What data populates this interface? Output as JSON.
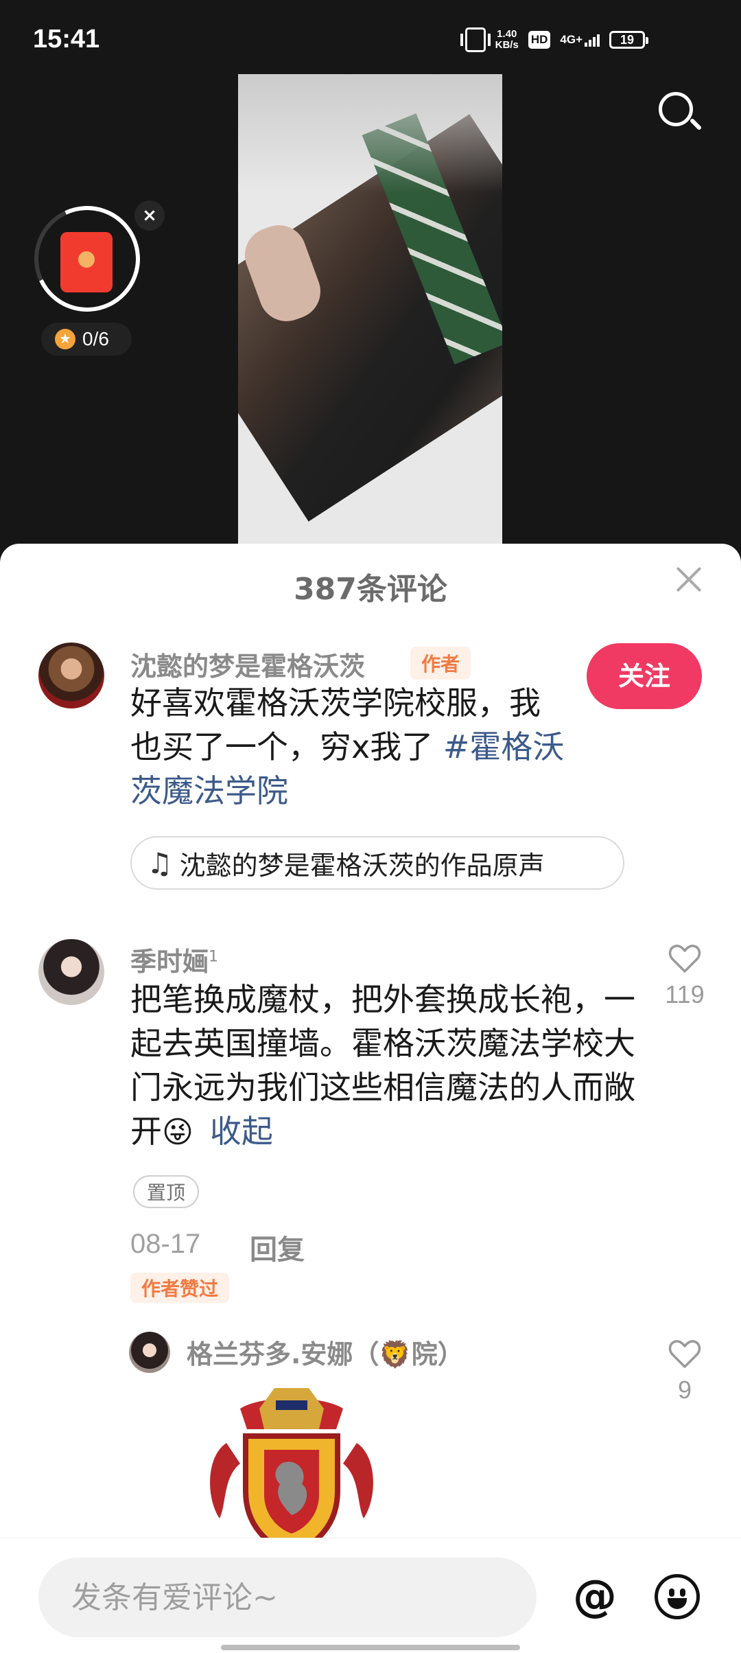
{
  "status_bar": {
    "time": "15:41",
    "speed_value": "1.40",
    "speed_unit": "KB/s",
    "hd": "HD",
    "network": "4G+",
    "battery": "19"
  },
  "redpacket": {
    "close": "×",
    "progress": "0/6",
    "progress_fraction": 0.0
  },
  "sheet": {
    "title": "387条评论"
  },
  "post": {
    "author": "沈懿的梦是霍格沃茨",
    "author_tag": "作者",
    "follow": "关注",
    "text": "好喜欢霍格沃茨学院校服，我也买了一个，穷x我了 ",
    "hashtag": "#霍格沃茨魔法学院",
    "music": "沈懿的梦是霍格沃茨的作品原声"
  },
  "comment": {
    "user": "季时婳",
    "user_sup": "1",
    "text": "把笔换成魔杖，把外套换成长袍，一起去英国撞墙。霍格沃茨魔法学校大门永远为我们这些相信魔法的人而敞开",
    "emoji": "😜",
    "collapse": "收起",
    "pin": "置顶",
    "date": "08-17",
    "reply": "回复",
    "liked_by_author": "作者赞过",
    "likes": "119"
  },
  "reply": {
    "user": "格兰芬多.安娜（🦁院）",
    "likes": "9"
  },
  "input": {
    "placeholder": "发条有爱评论~",
    "at": "@"
  },
  "colors": {
    "accent": "#f03a63",
    "link": "#3c5a8a",
    "author_tag": "#f07b43"
  }
}
